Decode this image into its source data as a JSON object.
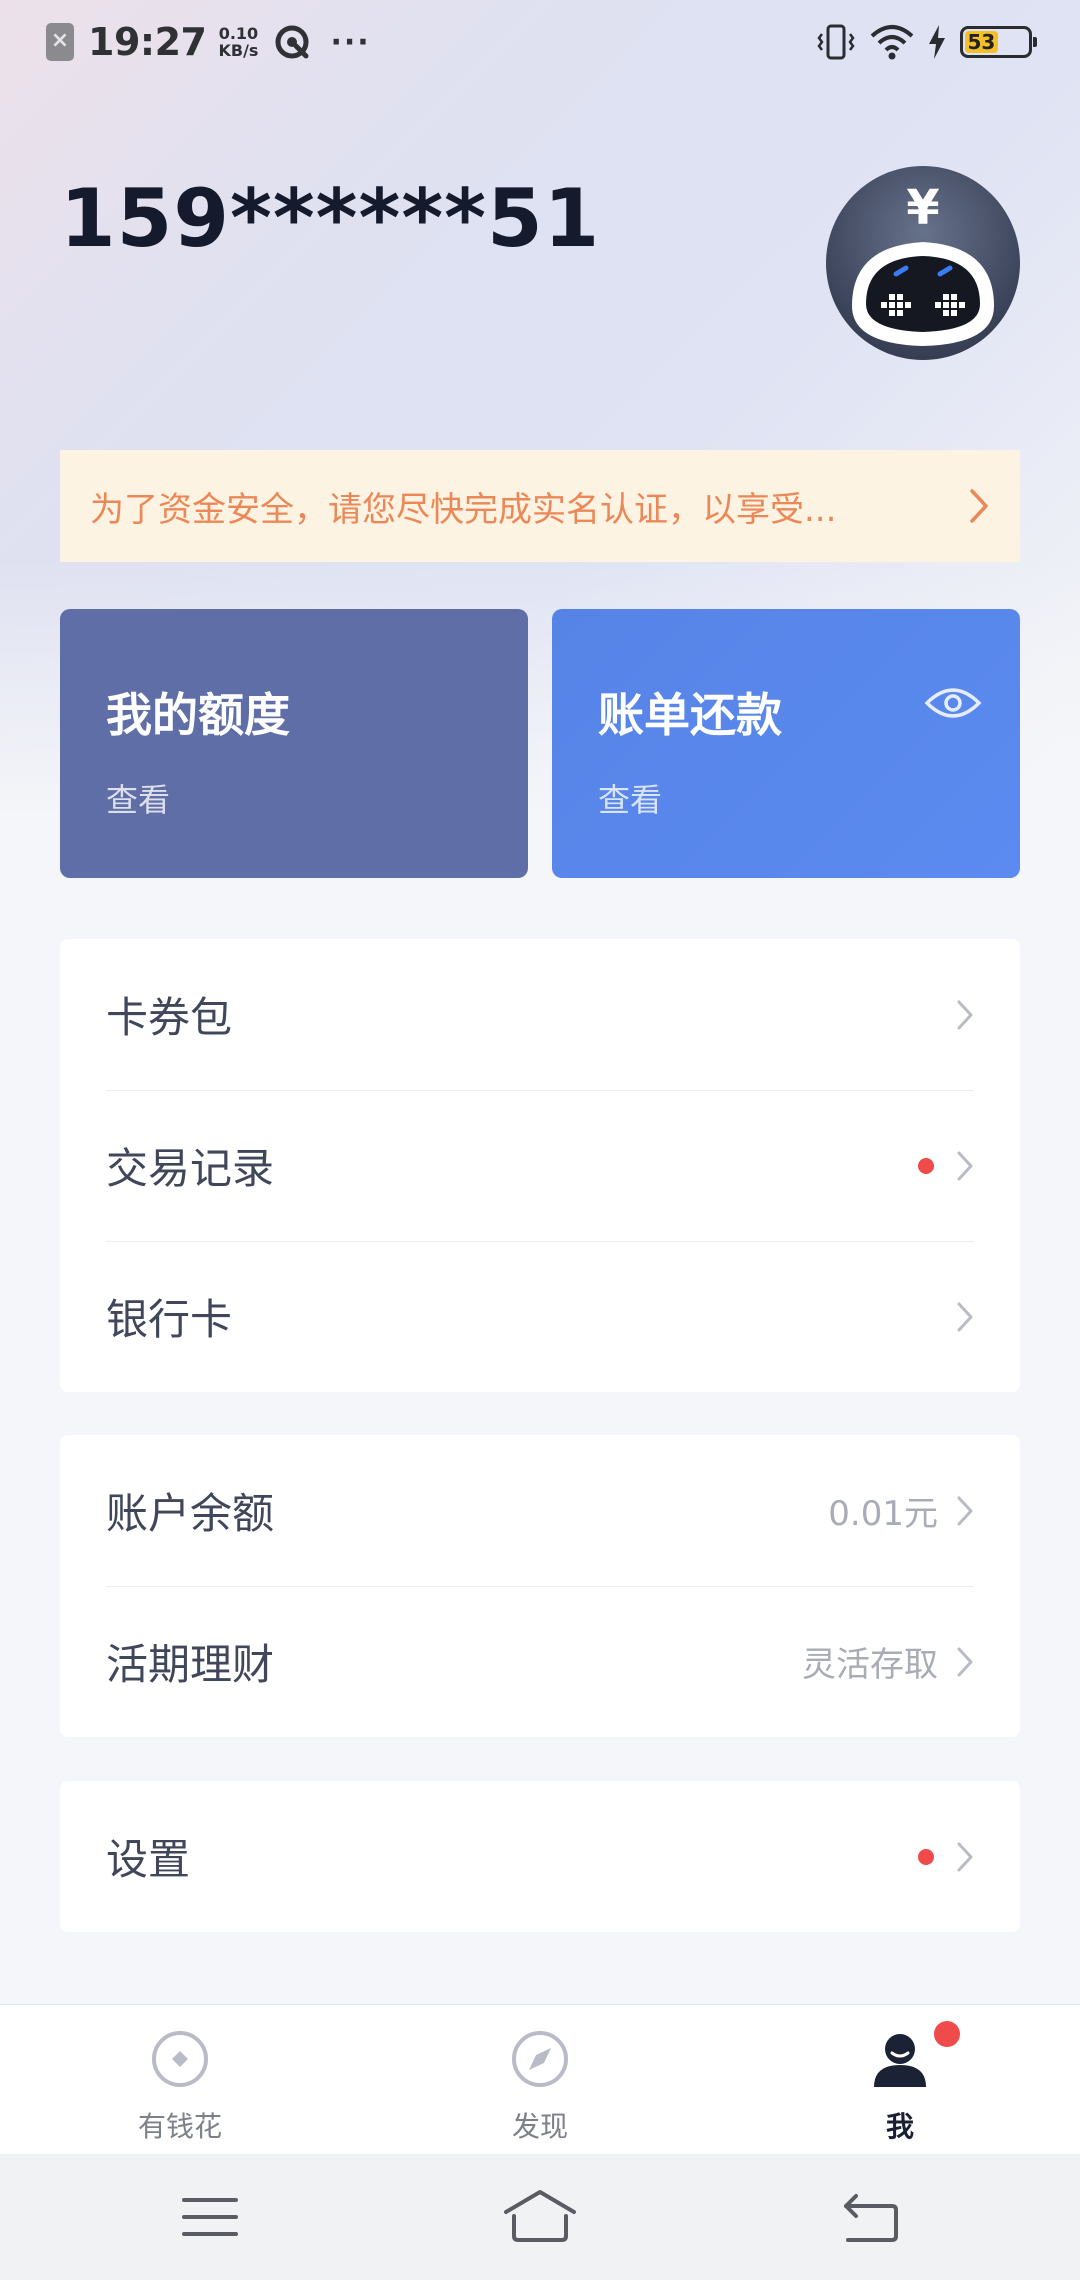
{
  "status_bar": {
    "time": "19:27",
    "net_speed_value": "0.10",
    "net_speed_unit": "KB/s",
    "more": "···",
    "battery": "53"
  },
  "header": {
    "phone": "159******51"
  },
  "notice": {
    "text": "为了资金安全，请您尽快完成实名认证，以享受..."
  },
  "cards": {
    "quota": {
      "title": "我的额度",
      "sub": "查看"
    },
    "bill": {
      "title": "账单还款",
      "sub": "查看"
    }
  },
  "group1": {
    "coupons": "卡券包",
    "transactions": "交易记录",
    "bank_card": "银行卡"
  },
  "group2": {
    "balance_label": "账户余额",
    "balance_value": "0.01元",
    "wealth_label": "活期理财",
    "wealth_value": "灵活存取"
  },
  "group3": {
    "settings": "设置"
  },
  "tabs": {
    "spend": "有钱花",
    "discover": "发现",
    "me": "我"
  },
  "colors": {
    "accent_red": "#ef4b4b",
    "notice_text": "#ec8857",
    "card_quota": "#5f6ea7",
    "card_bill": "#5683e6"
  }
}
